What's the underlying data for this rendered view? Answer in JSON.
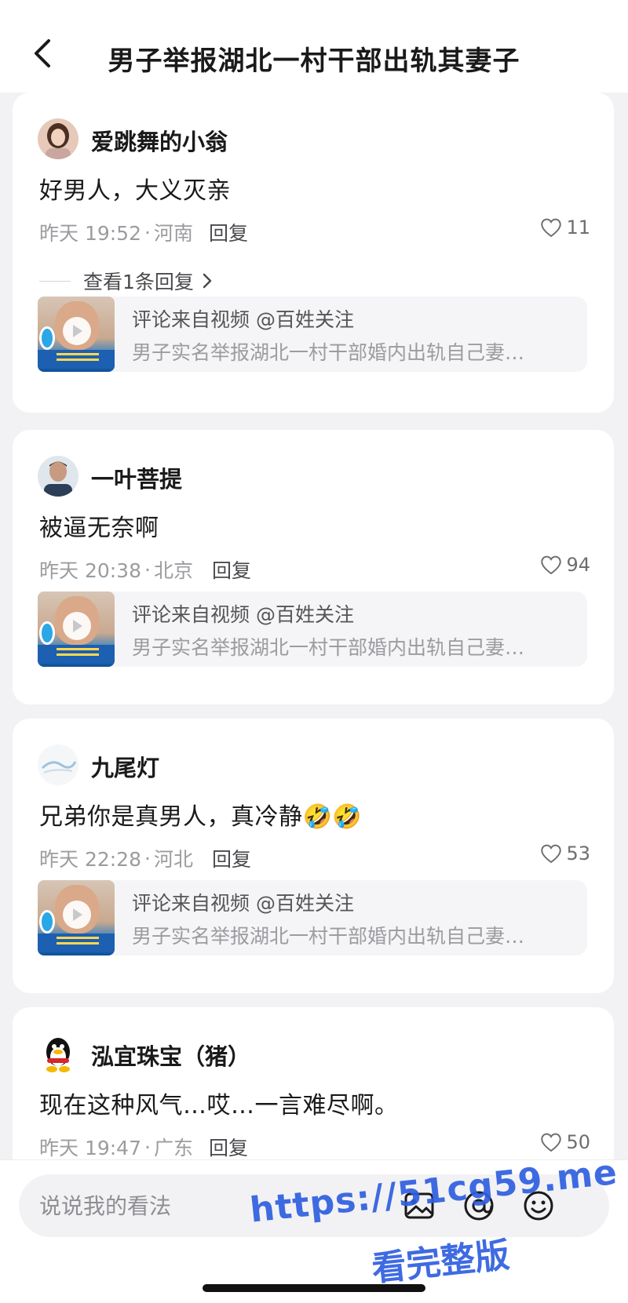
{
  "header": {
    "title": "男子举报湖北一村干部出轨其妻子"
  },
  "comments": [
    {
      "username": "爱跳舞的小翁",
      "text": "好男人，大义灭亲",
      "time": "昨天 19:52",
      "location": "河南",
      "reply_label": "回复",
      "likes": "11",
      "view_replies": "查看1条回复",
      "video_source": "评论来自视频 @百姓关注",
      "video_title": "男子实名举报湖北一村干部婚内出轨自己妻…"
    },
    {
      "username": "一叶菩提",
      "text": "被逼无奈啊",
      "time": "昨天 20:38",
      "location": "北京",
      "reply_label": "回复",
      "likes": "94",
      "video_source": "评论来自视频 @百姓关注",
      "video_title": "男子实名举报湖北一村干部婚内出轨自己妻…"
    },
    {
      "username": "九尾灯",
      "text": "兄弟你是真男人，真冷静",
      "emoji": "🤣🤣",
      "time": "昨天 22:28",
      "location": "河北",
      "reply_label": "回复",
      "likes": "53",
      "video_source": "评论来自视频 @百姓关注",
      "video_title": "男子实名举报湖北一村干部婚内出轨自己妻…"
    },
    {
      "username": "泓宜珠宝（猪）",
      "text": "现在这种风气…哎…一言难尽啊。",
      "time": "昨天 19:47",
      "location": "广东",
      "reply_label": "回复",
      "likes": "50"
    }
  ],
  "meta_separator": "·",
  "input": {
    "placeholder": "说说我的看法"
  },
  "watermark": {
    "url": "https://51cg59.me",
    "subtitle": "看完整版"
  },
  "colors": {
    "background": "#f2f2f4",
    "card": "#ffffff",
    "meta_text": "#9c9ca0",
    "watermark": "#2f5fe0"
  }
}
